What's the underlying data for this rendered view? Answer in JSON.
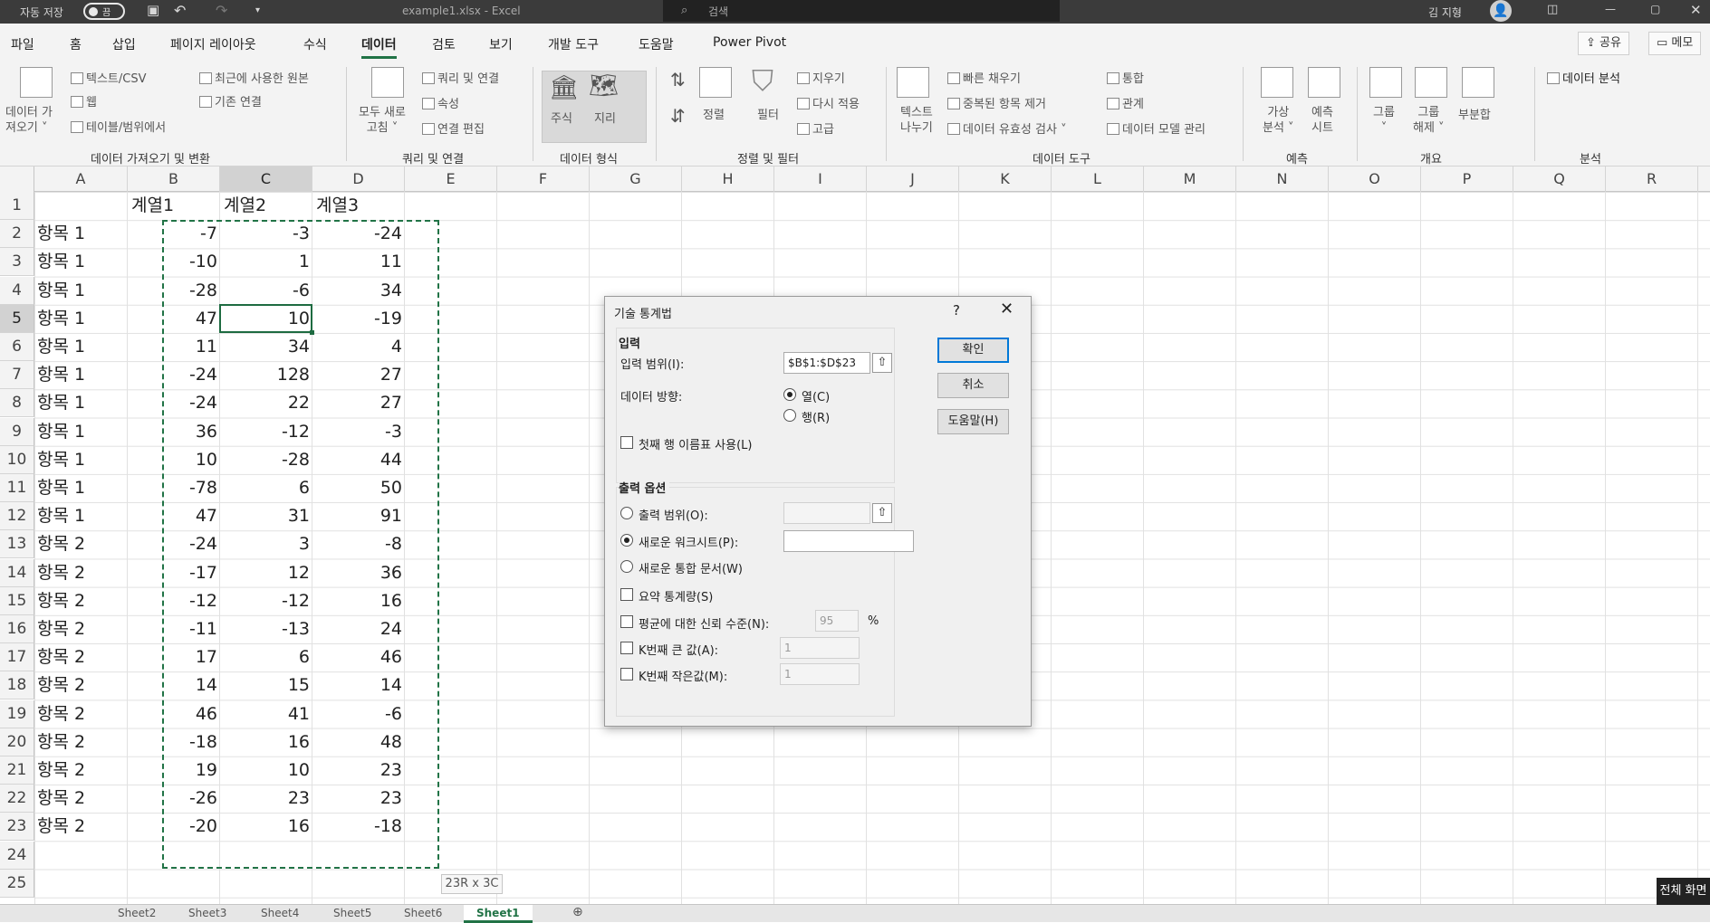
{
  "titlebar": {
    "autosave_label": "자동 저장",
    "toggle_state": "끔",
    "filename": "example1.xlsx  -  Excel",
    "search_placeholder": "검색",
    "user_name": "김 지형"
  },
  "menu": {
    "items": [
      "파일",
      "홈",
      "삽입",
      "페이지 레이아웃",
      "수식",
      "데이터",
      "검토",
      "보기",
      "개발 도구",
      "도움말",
      "Power Pivot"
    ],
    "active": "데이터",
    "share": "공유",
    "memo": "메모"
  },
  "ribbon": {
    "get_data": {
      "label": "데이터 가\n져오기 ˅",
      "items": [
        "텍스트/CSV",
        "웹",
        "테이블/범위에서",
        "최근에 사용한 원본",
        "기존 연결"
      ],
      "group": "데이터 가져오기 및 변환"
    },
    "queries": {
      "refresh": "모두 새로\n고침 ˅",
      "items": [
        "쿼리 및 연결",
        "속성",
        "연결 편집"
      ],
      "group": "쿼리 및 연결"
    },
    "types": {
      "items": [
        "주식",
        "지리"
      ],
      "group": "데이터 형식"
    },
    "sort": {
      "sort": "정렬",
      "filter": "필터",
      "items": [
        "지우기",
        "다시 적용",
        "고급"
      ],
      "group": "정렬 및 필터"
    },
    "tools": {
      "text_to_cols": "텍스트\n나누기",
      "items": [
        "빠른 채우기",
        "중복된 항목 제거",
        "데이터 유효성 검사 ˅",
        "통합",
        "관계",
        "데이터 모델 관리"
      ],
      "group": "데이터 도구"
    },
    "forecast": {
      "items": [
        "가상\n분석 ˅",
        "예측\n시트"
      ],
      "group": "예측"
    },
    "outline": {
      "items": [
        "그룹\n˅",
        "그룹\n해제 ˅",
        "부분합"
      ],
      "group": "개요"
    },
    "analysis": {
      "items": [
        "데이터 분석"
      ],
      "group": "분석"
    }
  },
  "sheet": {
    "columns": [
      "A",
      "B",
      "C",
      "D",
      "E",
      "F",
      "G",
      "H",
      "I",
      "J",
      "K",
      "L",
      "M",
      "N",
      "O",
      "P",
      "Q",
      "R"
    ],
    "row_numbers": [
      "1",
      "2",
      "3",
      "4",
      "5",
      "6",
      "7",
      "8",
      "9",
      "10",
      "11",
      "12",
      "13",
      "14",
      "15",
      "16",
      "17",
      "18",
      "19",
      "20",
      "21",
      "22",
      "23",
      "24",
      "25"
    ],
    "headers": [
      "계열1",
      "계열2",
      "계열3"
    ],
    "rows": [
      [
        "항목 1",
        "-7",
        "-3",
        "-24"
      ],
      [
        "항목 1",
        "-10",
        "1",
        "11"
      ],
      [
        "항목 1",
        "-28",
        "-6",
        "34"
      ],
      [
        "항목 1",
        "47",
        "10",
        "-19"
      ],
      [
        "항목 1",
        "11",
        "34",
        "4"
      ],
      [
        "항목 1",
        "-24",
        "128",
        "27"
      ],
      [
        "항목 1",
        "-24",
        "22",
        "27"
      ],
      [
        "항목 1",
        "36",
        "-12",
        "-3"
      ],
      [
        "항목 1",
        "10",
        "-28",
        "44"
      ],
      [
        "항목 1",
        "-78",
        "6",
        "50"
      ],
      [
        "항목 1",
        "47",
        "31",
        "91"
      ],
      [
        "항목 2",
        "-24",
        "3",
        "-8"
      ],
      [
        "항목 2",
        "-17",
        "12",
        "36"
      ],
      [
        "항목 2",
        "-12",
        "-12",
        "16"
      ],
      [
        "항목 2",
        "-11",
        "-13",
        "24"
      ],
      [
        "항목 2",
        "17",
        "6",
        "46"
      ],
      [
        "항목 2",
        "14",
        "15",
        "14"
      ],
      [
        "항목 2",
        "46",
        "41",
        "-6"
      ],
      [
        "항목 2",
        "-18",
        "16",
        "48"
      ],
      [
        "항목 2",
        "19",
        "10",
        "23"
      ],
      [
        "항목 2",
        "-26",
        "23",
        "23"
      ],
      [
        "항목 2",
        "-20",
        "16",
        "-18"
      ]
    ],
    "selection_tip": "23R x 3C",
    "tabs": [
      "Sheet2",
      "Sheet3",
      "Sheet4",
      "Sheet5",
      "Sheet6",
      "Sheet1"
    ],
    "active_tab": "Sheet1",
    "fullscreen": "전체 화면"
  },
  "dialog": {
    "title": "기술 통계법",
    "help": "?",
    "input_section": "입력",
    "input_range_label": "입력 범위(I):",
    "input_range_value": "$B$1:$D$23",
    "direction_label": "데이터 방향:",
    "dir_col": "열(C)",
    "dir_row": "행(R)",
    "first_row_label": "첫째 행 이름표 사용(L)",
    "output_section": "출력 옵션",
    "out_range": "출력 범위(O):",
    "new_sheet": "새로운 워크시트(P):",
    "new_book": "새로운 통합 문서(W)",
    "summary": "요약 통계량(S)",
    "confidence": "평균에 대한 신뢰 수준(N):",
    "confidence_value": "95",
    "percent": "%",
    "kth_large": "K번째 큰 값(A):",
    "kth_large_value": "1",
    "kth_small": "K번째 작은값(M):",
    "kth_small_value": "1",
    "ok": "확인",
    "cancel": "취소",
    "helpbtn": "도움말(H)"
  }
}
